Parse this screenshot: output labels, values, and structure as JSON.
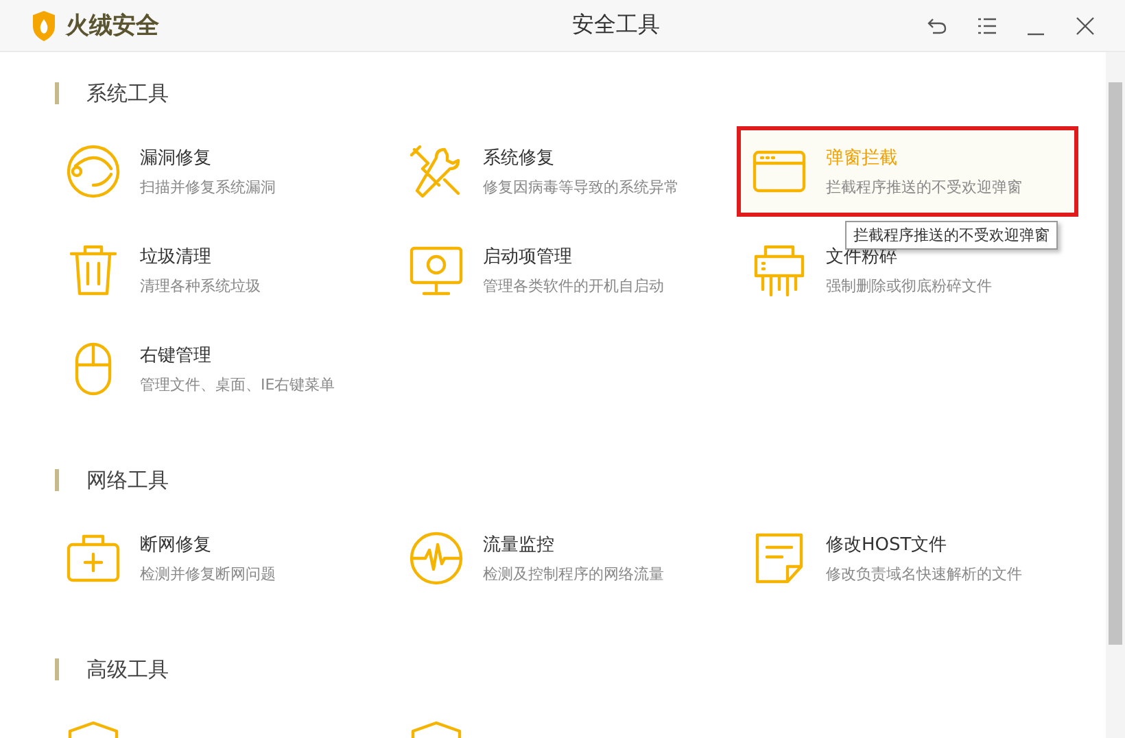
{
  "window": {
    "app_name": "火绒安全",
    "title": "安全工具"
  },
  "sections": [
    {
      "heading": "系统工具",
      "items": [
        {
          "kind": "ring",
          "title": "漏洞修复",
          "desc": "扫描并修复系统漏洞",
          "selected": false
        },
        {
          "kind": "tools",
          "title": "系统修复",
          "desc": "修复因病毒等导致的系统异常",
          "selected": false
        },
        {
          "kind": "window",
          "title": "弹窗拦截",
          "desc": "拦截程序推送的不受欢迎弹窗",
          "selected": true
        },
        {
          "kind": "trash",
          "title": "垃圾清理",
          "desc": "清理各种系统垃圾",
          "selected": false
        },
        {
          "kind": "monitor",
          "title": "启动项管理",
          "desc": "管理各类软件的开机自启动",
          "selected": false
        },
        {
          "kind": "shredder",
          "title": "文件粉碎",
          "desc": "强制删除或彻底粉碎文件",
          "selected": false
        },
        {
          "kind": "mouse",
          "title": "右键管理",
          "desc": "管理文件、桌面、IE右键菜单",
          "selected": false
        }
      ]
    },
    {
      "heading": "网络工具",
      "items": [
        {
          "kind": "kit",
          "title": "断网修复",
          "desc": "检测并修复断网问题",
          "selected": false
        },
        {
          "kind": "pulse",
          "title": "流量监控",
          "desc": "检测及控制程序的网络流量",
          "selected": false
        },
        {
          "kind": "note",
          "title": "修改HOST文件",
          "desc": "修改负责域名快速解析的文件",
          "selected": false
        }
      ]
    },
    {
      "heading": "高级工具",
      "items": [
        {
          "kind": "shield",
          "selected": false
        },
        {
          "kind": "shield",
          "selected": false
        }
      ]
    }
  ],
  "tooltip": {
    "text": "拦截程序推送的不受欢迎弹窗"
  }
}
